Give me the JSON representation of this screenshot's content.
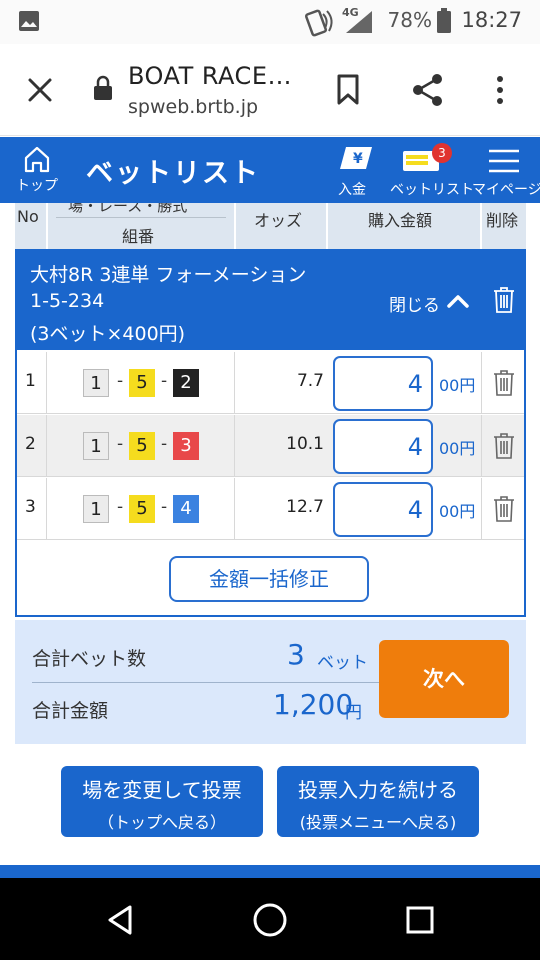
{
  "status_bar": {
    "network": "4G",
    "battery": "78%",
    "time": "18:27"
  },
  "browser": {
    "title": "BOAT RACE…",
    "url": "spweb.brtb.jp"
  },
  "app_header": {
    "home_label": "トップ",
    "title": "ベットリスト",
    "deposit_label": "入金",
    "betlist_label": "ベットリスト",
    "betlist_badge": "3",
    "mypage_label": "マイページ"
  },
  "table_header": {
    "no": "No",
    "combo_top": "場・レース・勝式",
    "combo": "組番",
    "odds": "オッズ",
    "amount": "購入金額",
    "delete": "削除"
  },
  "group": {
    "line1": "大村8R 3連単 フォーメーション",
    "line2": "1-5-234",
    "line3": "(3ベット×400円)",
    "close_label": "閉じる"
  },
  "rows": [
    {
      "no": "1",
      "b1": "1",
      "b2": "5",
      "b3": "2",
      "odds": "7.7",
      "amount": "4",
      "unit": "00円"
    },
    {
      "no": "2",
      "b1": "1",
      "b2": "5",
      "b3": "3",
      "odds": "10.1",
      "amount": "4",
      "unit": "00円"
    },
    {
      "no": "3",
      "b1": "1",
      "b2": "5",
      "b3": "4",
      "odds": "12.7",
      "amount": "4",
      "unit": "00円"
    }
  ],
  "bulk_button": "金額一括修正",
  "summary": {
    "bets_label": "合計ベット数",
    "bets_value": "3",
    "bets_unit": "ベット",
    "amount_label": "合計金額",
    "amount_value": "1,200",
    "amount_unit": "円",
    "next_label": "次へ"
  },
  "bottom_buttons": {
    "change_main": "場を変更して投票",
    "change_sub": "（トップへ戻る）",
    "continue_main": "投票入力を続ける",
    "continue_sub": "(投票メニューへ戻る)"
  },
  "colors": {
    "primary": "#1a66cc",
    "accent": "#ef7d0c",
    "boat1": "#ececec",
    "boat2": "#222222",
    "boat3": "#e8484a",
    "boat4": "#3b82e0",
    "boat5": "#f5dc1e"
  }
}
